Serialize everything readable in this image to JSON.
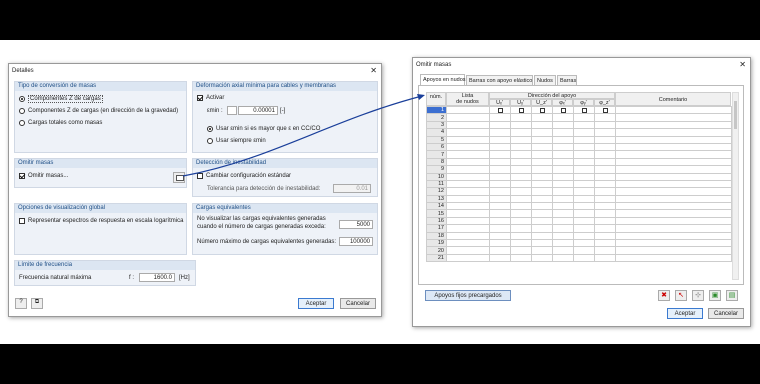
{
  "detalles": {
    "title": "Detalles",
    "close": "✕",
    "g1": {
      "title": "Tipo de conversión de masas",
      "opts": [
        "Componentes Z de cargas",
        "Componentes Z de cargas (en dirección de la gravedad)",
        "Cargas totales como masas"
      ]
    },
    "g2": {
      "title": "Deformación axial mínima para cables y membranas",
      "activar": "Activar",
      "emin_label": "εmin :",
      "emin_value": "0.00001",
      "unit": "[-]",
      "r1": "Usar εmin si es mayor que ε en CC/CO",
      "r2": "Usar siempre εmin"
    },
    "g3": {
      "title": "Omitir masas",
      "cb": "Omitir masas..."
    },
    "g4": {
      "title": "Detección de inestabilidad",
      "cb": "Cambiar configuración estándar",
      "tol_label": "Tolerancia para detección de inestabilidad:",
      "tol_value": "0.01"
    },
    "g5": {
      "title": "Opciones de visualización global",
      "cb": "Representar espectros de respuesta en escala logarítmica"
    },
    "g6": {
      "title": "Cargas equivalentes",
      "l1": "No visualizar las cargas equivalentes generadas",
      "l2": "cuando el número de cargas generadas exceda:",
      "v1": "5000",
      "l3": "Número máximo de cargas equivalentes generadas:",
      "v2": "100000"
    },
    "g7": {
      "title": "Límite de frecuencia",
      "label": "Frecuencia natural máxima",
      "f": "f :",
      "value": "1600.0",
      "unit": "[Hz]"
    },
    "accept": "Aceptar",
    "cancel": "Cancelar"
  },
  "omitir": {
    "title": "Omitir masas",
    "close": "✕",
    "tabs": [
      "Apoyos en nudos",
      "Barras con apoyo elástico",
      "Nudos",
      "Barras"
    ],
    "hdr": {
      "num": "núm.",
      "lista1": "Lista",
      "lista2": "de nudos",
      "dir": "Dirección del apoyo",
      "cols": [
        "Uₓ'",
        "Uᵧ'",
        "U_z'",
        "φₓ'",
        "φᵧ'",
        "φ_z'"
      ],
      "comment": "Comentario"
    },
    "rows": [
      "1",
      "2",
      "3",
      "4",
      "5",
      "6",
      "7",
      "8",
      "9",
      "10",
      "11",
      "12",
      "13",
      "14",
      "15",
      "16",
      "17",
      "18",
      "19",
      "20",
      "21"
    ],
    "precargados": "Apoyos fijos precargados",
    "accept": "Aceptar",
    "cancel": "Cancelar"
  },
  "colors": {
    "accent": "#1f4f86",
    "arrow": "#1a3f9a"
  }
}
